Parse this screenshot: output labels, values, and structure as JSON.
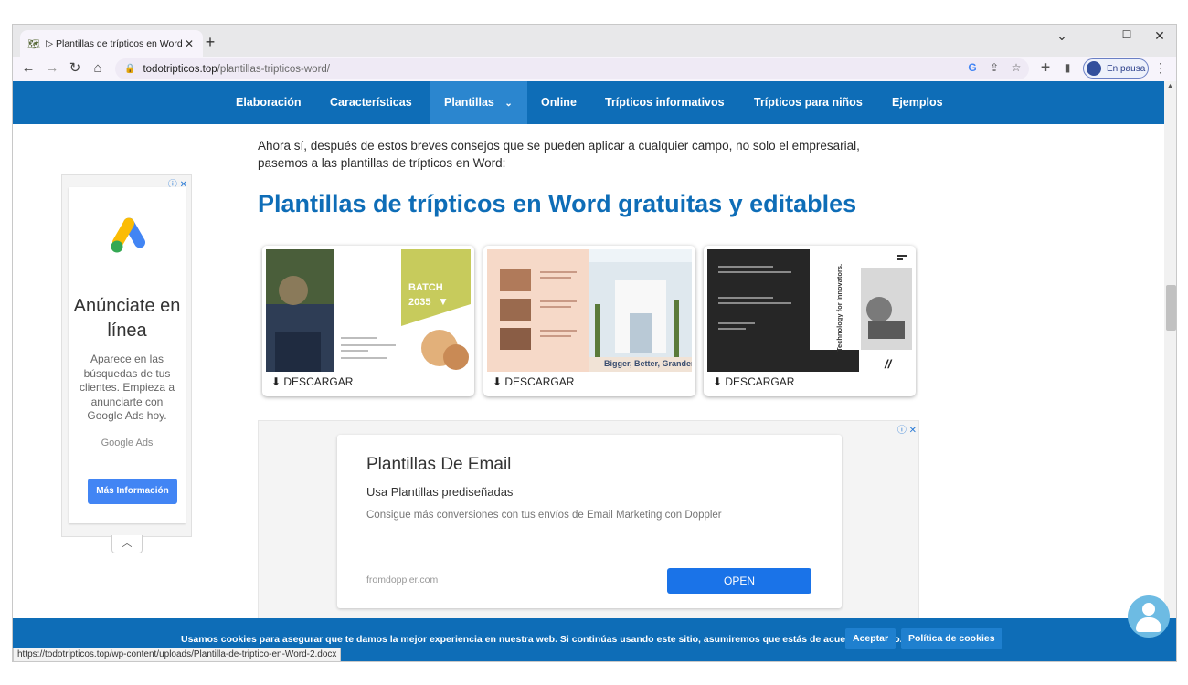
{
  "browser": {
    "tab_title": "▷ Plantillas de trípticos en Word",
    "url_host": "todotripticos.top",
    "url_path": "/plantillas-tripticos-word/",
    "profile_label": "En pausa",
    "status_url": "https://todotripticos.top/wp-content/uploads/Plantilla-de-triptico-en-Word-2.docx"
  },
  "nav": {
    "items": [
      "Elaboración",
      "Características",
      "Plantillas",
      "Online",
      "Trípticos informativos",
      "Trípticos para niños",
      "Ejemplos"
    ],
    "active_index": 2
  },
  "article": {
    "intro": "Ahora sí, después de estos breves consejos que se pueden aplicar a cualquier campo, no solo el empresarial, pasemos a las plantillas de trípticos en Word:",
    "heading": "Plantillas de trípticos en Word gratuitas y editables",
    "download_label": "⬇ DESCARGAR",
    "cards": [
      {
        "badge_line1": "BATCH",
        "badge_line2": "2035"
      },
      {
        "tagline": "Bigger, Better, Grander"
      },
      {
        "side_text": "Technology for Innovators."
      }
    ]
  },
  "side_ad": {
    "headline": "Anúnciate en línea",
    "body": "Aparece en las búsquedas de tus clientes. Empieza a anunciarte con Google Ads hoy.",
    "brand": "Google Ads",
    "button": "Más Información"
  },
  "main_ad": {
    "title": "Plantillas De Email",
    "subtitle": "Usa Plantillas prediseñadas",
    "description": "Consigue más conversiones con tus envíos de Email Marketing con Doppler",
    "domain": "fromdoppler.com",
    "button": "OPEN"
  },
  "cookie": {
    "message": "Usamos cookies para asegurar que te damos la mejor experiencia en nuestra web. Si continúas usando este sitio, asumiremos que estás de acuerdo con ello.",
    "accept": "Aceptar",
    "policy": "Política de cookies"
  },
  "colors": {
    "brand_blue": "#0e6db7",
    "nav_active": "#2b86cf",
    "ad_button": "#1a73e8"
  }
}
